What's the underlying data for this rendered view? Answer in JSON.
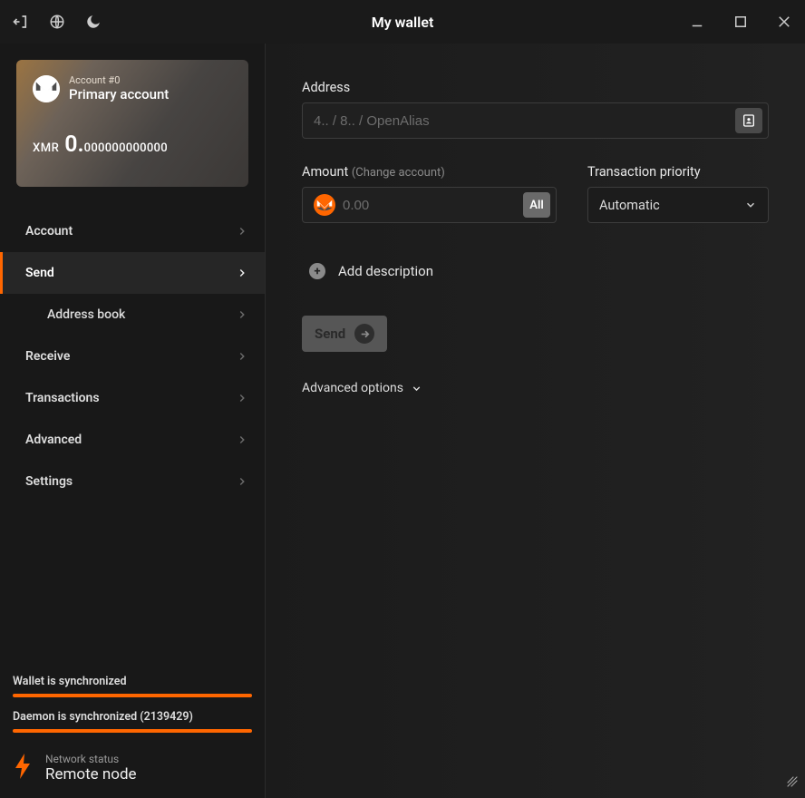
{
  "window": {
    "title": "My wallet"
  },
  "account": {
    "num_label": "Account #0",
    "name": "Primary account",
    "currency": "XMR",
    "balance_int": "0.",
    "balance_frac": "000000000000"
  },
  "nav": {
    "account": "Account",
    "send": "Send",
    "address_book": "Address book",
    "receive": "Receive",
    "transactions": "Transactions",
    "advanced": "Advanced",
    "settings": "Settings"
  },
  "status": {
    "wallet_sync": "Wallet is synchronized",
    "daemon_sync": "Daemon is synchronized (2139429)",
    "network_label": "Network status",
    "network_value": "Remote node"
  },
  "form": {
    "address_label": "Address",
    "address_placeholder": "4.. / 8.. / OpenAlias",
    "amount_label": "Amount",
    "amount_hint": "(Change account)",
    "amount_placeholder": "0.00",
    "all_btn": "All",
    "priority_label": "Transaction priority",
    "priority_value": "Automatic",
    "add_desc": "Add description",
    "send_btn": "Send",
    "adv_opt": "Advanced options"
  }
}
